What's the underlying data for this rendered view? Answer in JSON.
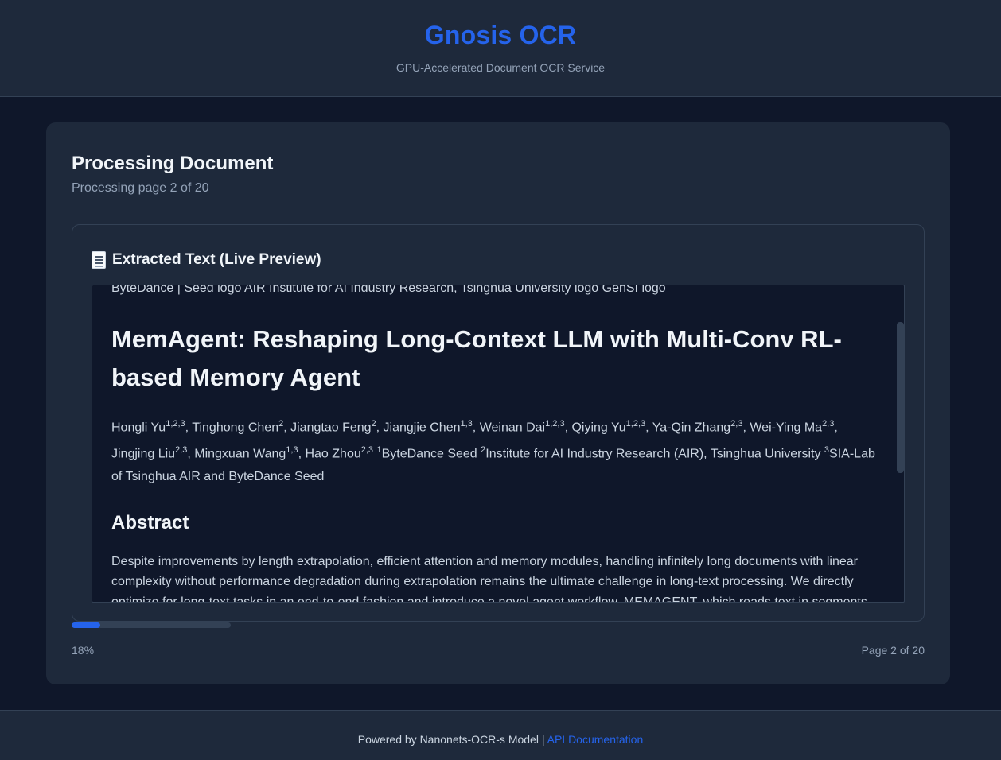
{
  "header": {
    "brand": "Gnosis OCR",
    "tagline": "GPU-Accelerated Document OCR Service"
  },
  "processing": {
    "title": "Processing Document",
    "status": "Processing page 2 of 20"
  },
  "preview": {
    "icon": "document-icon",
    "title": "Extracted Text (Live Preview)",
    "logos_line": "ByteDance | Seed logo AIR Institute for AI Industry Research, Tsinghua University logo GenSI logo",
    "doc_title": "MemAgent: Reshaping Long-Context LLM with Multi-Conv RL-based Memory Agent",
    "authors": [
      {
        "name": "Hongli Yu",
        "aff": "1,2,3",
        "sep": ", "
      },
      {
        "name": "Tinghong Chen",
        "aff": "2",
        "sep": ", "
      },
      {
        "name": "Jiangtao Feng",
        "aff": "2",
        "sep": ", "
      },
      {
        "name": "Jiangjie Chen",
        "aff": "1,3",
        "sep": ", "
      },
      {
        "name": "Weinan Dai",
        "aff": "1,2,3",
        "sep": ", "
      },
      {
        "name": "Qiying Yu",
        "aff": "1,2,3",
        "sep": ", "
      },
      {
        "name": "Ya-Qin Zhang",
        "aff": "2,3",
        "sep": ", "
      },
      {
        "name": "Wei-Ying Ma",
        "aff": "2,3",
        "sep": ", "
      },
      {
        "name": "Jingjing Liu",
        "aff": "2,3",
        "sep": ", "
      },
      {
        "name": "Mingxuan Wang",
        "aff": "1,3",
        "sep": ", "
      },
      {
        "name": "Hao Zhou",
        "aff": "2,3",
        "sep": " "
      }
    ],
    "affiliations": [
      {
        "num": "1",
        "text": "ByteDance Seed "
      },
      {
        "num": "2",
        "text": "Institute for AI Industry Research (AIR), Tsinghua University "
      },
      {
        "num": "3",
        "text": "SIA-Lab of Tsinghua AIR and ByteDance Seed"
      }
    ],
    "abstract_heading": "Abstract",
    "abstract_body": "Despite improvements by length extrapolation, efficient attention and memory modules, handling infinitely long documents with linear complexity without performance degradation during extrapolation remains the ultimate challenge in long-text processing. We directly optimize for long-text tasks in an end-to-end fashion and introduce a novel agent workflow, MEMAGENT, which reads text in segments and updates the memory using an overwrite strategy. We extend the DAPO algorithm to facilitate training via independent-context multi-conversation generation."
  },
  "progress": {
    "fraction": 0.18,
    "percent_label": "18%",
    "page_label": "Page 2 of 20"
  },
  "footer": {
    "powered_by": "Powered by Nanonets-OCR-s Model | ",
    "api_link": "API Documentation"
  },
  "colors": {
    "accent": "#2563eb",
    "background": "#0f172a",
    "surface": "#1e293b"
  }
}
